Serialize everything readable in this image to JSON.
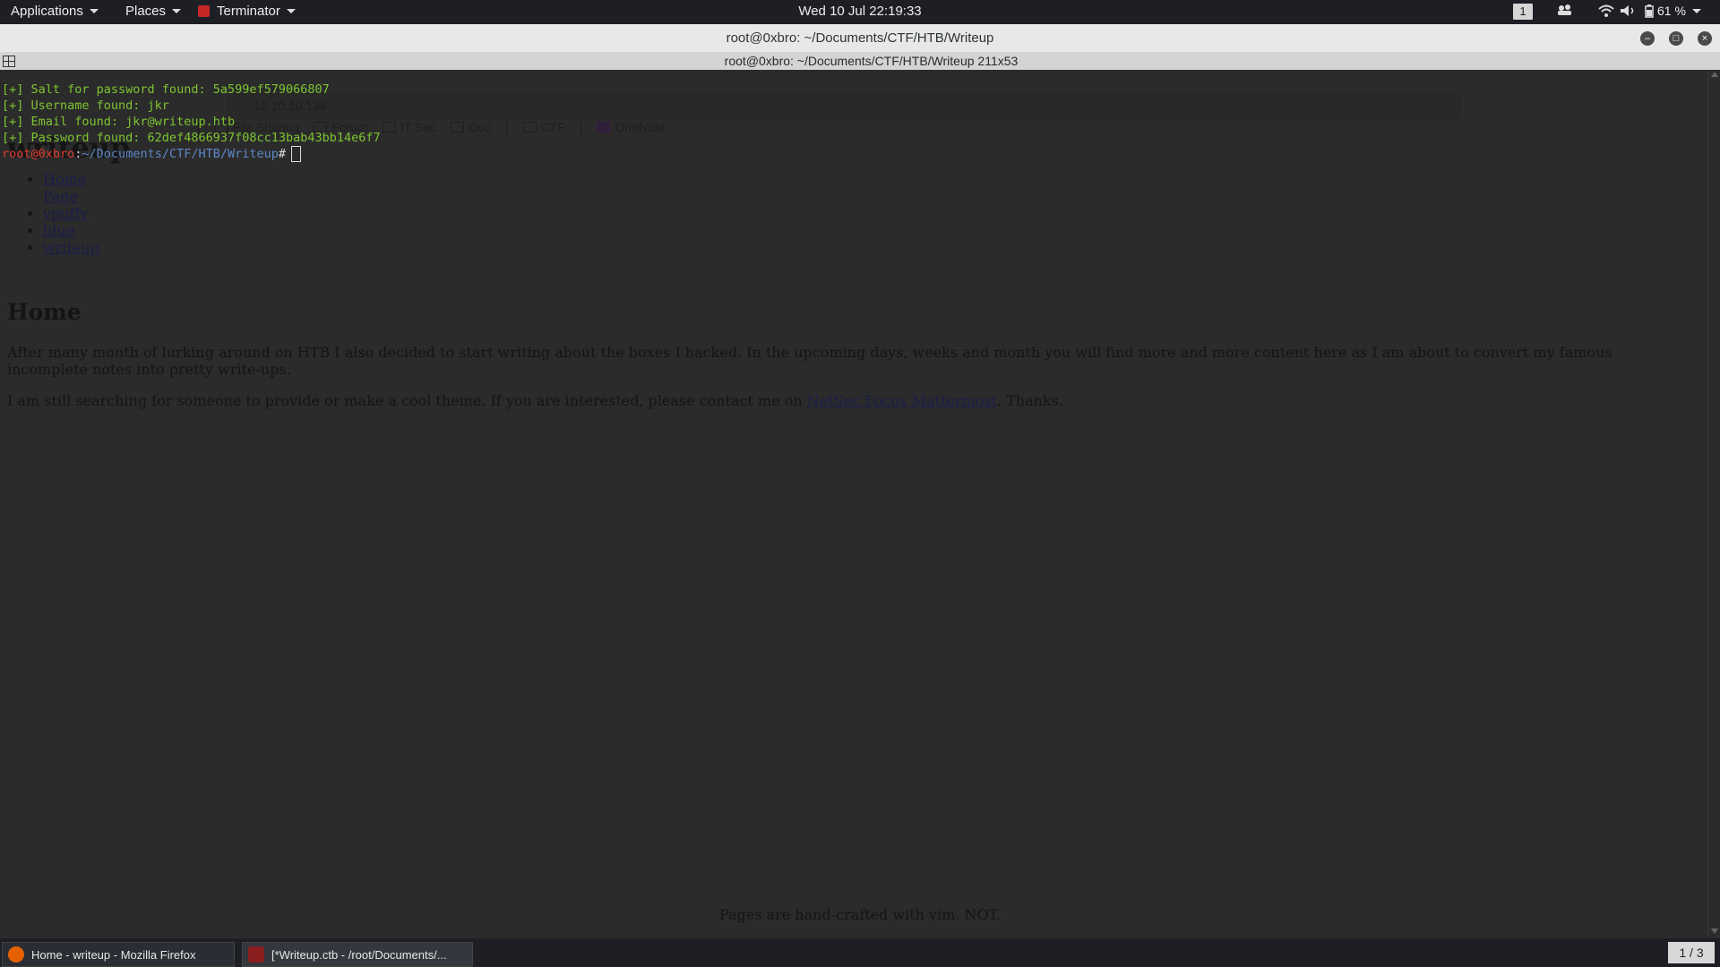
{
  "panel": {
    "applications": "Applications",
    "places": "Places",
    "terminator": "Terminator",
    "clock": "Wed 10 Jul  22:19:33",
    "workspace": "1",
    "battery": "61 %"
  },
  "window": {
    "title": "root@0xbro: ~/Documents/CTF/HTB/Writeup",
    "terminal_title": "root@0xbro: ~/Documents/CTF/HTB/Writeup 211x53"
  },
  "firefox_ghost": {
    "url_host": "10.10.10.138",
    "url_path": "/writeup/index.php?page=",
    "bookmarks": [
      "File Sharing",
      "Forum",
      "IT Sec",
      "Doc",
      "CTF",
      "OneNote"
    ]
  },
  "page": {
    "site_title": "writeup",
    "nav": [
      "Home Page",
      "ypuffy",
      "blue",
      "writeup"
    ],
    "heading": "Home",
    "p1": "After many month of lurking around on HTB I also decided to start writing about the boxes I hacked. In the upcoming days, weeks and month you will find more and more content here as I am about to convert my famous incomplete notes into pretty write-ups.",
    "p2_before": "I am still searching for someone to provide or make a cool theme. If you are interested, please contact me on ",
    "p2_link": "NetSec Focus Mattermost",
    "p2_after": ". Thanks.",
    "footer": "Pages are hand-crafted with vim. NOT."
  },
  "terminal": {
    "lines": [
      "[+] Salt for password found: 5a599ef579066807",
      "[+] Username found: jkr",
      "[+] Email found: jkr@writeup.htb",
      "[+] Password found: 62def4866937f08cc13bab43bb14e6f7"
    ],
    "prompt_user": "root@0xbro",
    "prompt_sep": ":",
    "prompt_path": "~/Documents/CTF/HTB/Writeup",
    "prompt_hash": "#"
  },
  "taskbar": {
    "task1": "Home - writeup - Mozilla Firefox",
    "task2": "[*Writeup.ctb - /root/Documents/...",
    "pager": "1 / 3"
  },
  "colors": {
    "terminal_green": "#7ec431",
    "prompt_red": "#e03c31",
    "prompt_blue": "#5d87c8"
  }
}
